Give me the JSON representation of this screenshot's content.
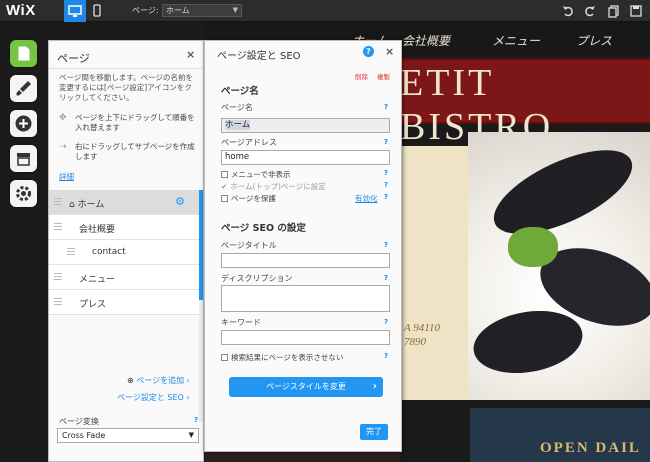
{
  "topbar": {
    "logo": "WiX",
    "page_label": "ページ:",
    "page_select": "ホーム"
  },
  "site": {
    "nav": [
      "ホーム",
      "会社概要",
      "メニュー",
      "プレス"
    ],
    "banner_title": "ETIT BISTRO",
    "cream_line1": "A 94110",
    "cream_line2": "7890",
    "sign_text": "OPEN DAIL"
  },
  "rail": {
    "icons": [
      "pages-icon",
      "brush-icon",
      "add-icon",
      "store-icon",
      "settings-icon"
    ]
  },
  "pages_panel": {
    "title": "ページ",
    "close": "×",
    "description": "ページ間を移動します。ページの名前を変更するには[ページ設定]アイコンをクリックしてください。",
    "tip_reorder": "ページを上下にドラッグして順番を入れ替えます",
    "tip_subpage": "右にドラッグしてサブページを作成します",
    "details_link": "詳細",
    "pages": [
      {
        "label": "ホーム"
      },
      {
        "label": "会社概要"
      },
      {
        "label": "contact"
      },
      {
        "label": "メニュー"
      },
      {
        "label": "プレス"
      }
    ],
    "add_page": "ページを追加",
    "page_settings_seo": "ページ設定と SEO",
    "transition_label": "ページ変換",
    "transition_help": "?",
    "transition_value": "Cross Fade"
  },
  "seo_panel": {
    "title": "ページ設定と SEO",
    "delete": "削除",
    "duplicate": "複製",
    "section_page_name": "ページ名",
    "page_name_label": "ページ名",
    "page_name_value": "ホーム",
    "page_address_label": "ページアドレス",
    "page_address_value": "home",
    "hide_from_menu": "メニューで非表示",
    "home_page": "ホーム(トップ)ページに設定",
    "protect_page": "ページを保護",
    "enable_link": "有効化",
    "section_seo": "ページ SEO の設定",
    "seo_title_label": "ページタイトル",
    "seo_desc_label": "ディスクリプション",
    "keywords_label": "キーワード",
    "hide_from_search": "検索結果にページを表示させない",
    "change_style_button": "ページスタイルを変更",
    "done_button": "完了",
    "help": "?"
  }
}
